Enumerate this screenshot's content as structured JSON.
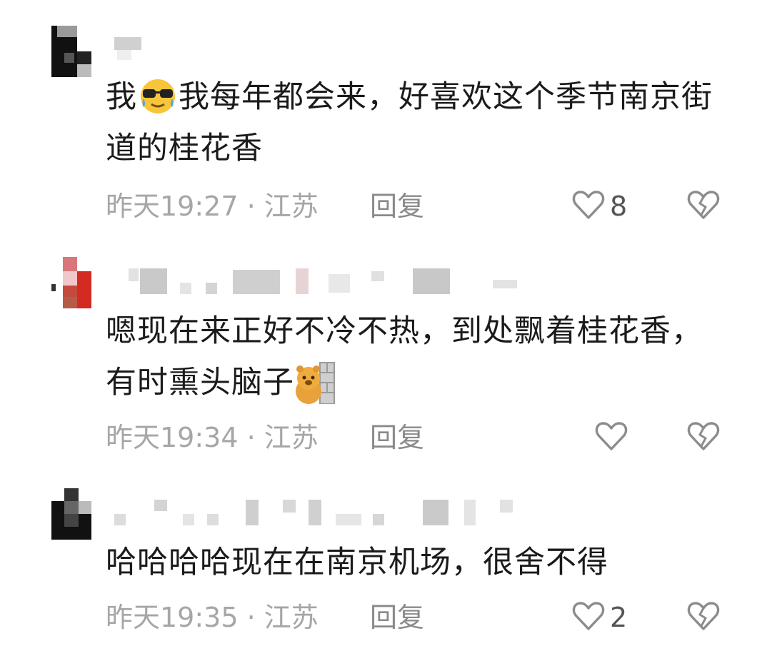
{
  "comments": [
    {
      "text_before": "我",
      "text_after": "我每年都会来，好喜欢这个季节南京街道的桂花香",
      "emoji": "cool-sunglasses-emoji",
      "time": "昨天19:27",
      "separator": "·",
      "location": "江苏",
      "reply_label": "回复",
      "likes": "8"
    },
    {
      "text_before": "嗯现在来正好不冷不热，到处飘着桂花香，有时熏头脑子",
      "text_after": "",
      "emoji": "hiding-bear-emoji",
      "time": "昨天19:34",
      "separator": "·",
      "location": "江苏",
      "reply_label": "回复",
      "likes": ""
    },
    {
      "text_before": "哈哈哈哈现在在南京机场，很舍不得",
      "text_after": "",
      "emoji": "",
      "time": "昨天19:35",
      "separator": "·",
      "location": "江苏",
      "reply_label": "回复",
      "likes": "2"
    }
  ],
  "colors": {
    "meta": "#a6a6a6",
    "text": "#1b1b1b",
    "icon": "#8c8c8c"
  }
}
